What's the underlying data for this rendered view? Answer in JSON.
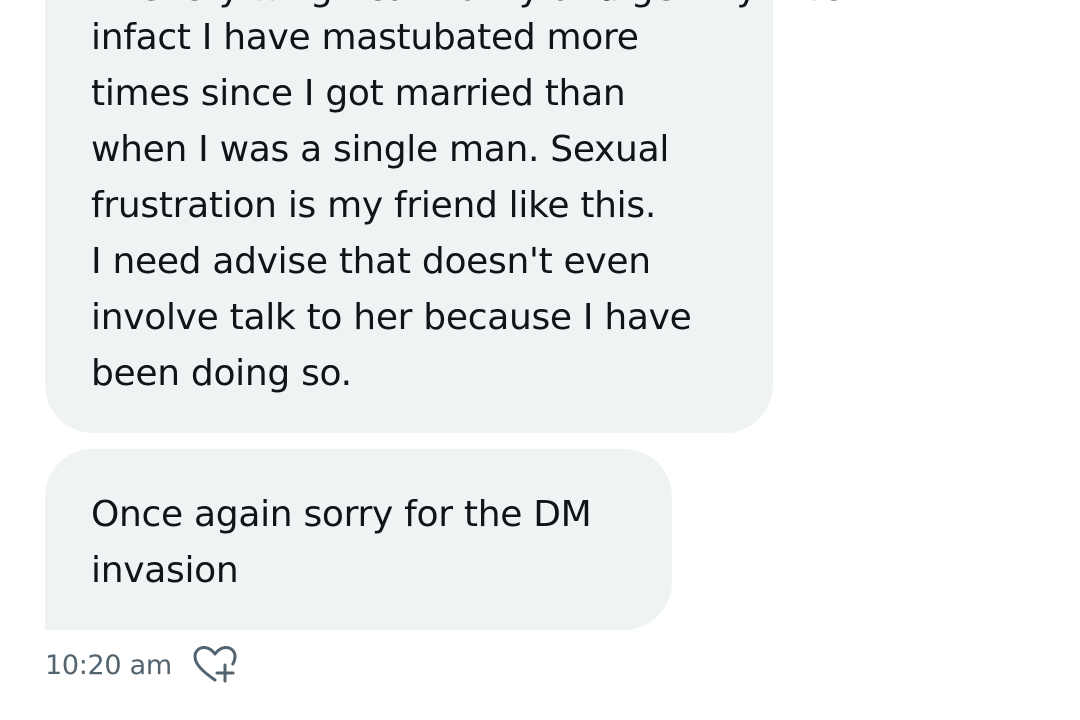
{
  "conversation": {
    "messages": [
      {
        "partial_top_line": "… everything I can to try and get my wife …",
        "lines": [
          "infact I have mastubated more",
          "times since I got married than",
          "when I was a single man. Sexual",
          "frustration is my friend like this.",
          "I need advise that doesn't even",
          "involve talk to her because I have",
          "been doing so."
        ]
      },
      {
        "lines": [
          "Once again sorry for the DM",
          "invasion"
        ]
      }
    ],
    "timestamp": "10:20 am",
    "react_icon": "heart-plus-icon"
  },
  "colors": {
    "bubble_bg": "#eff3f4",
    "text": "#0f1419",
    "muted": "#536471",
    "background": "#ffffff"
  }
}
